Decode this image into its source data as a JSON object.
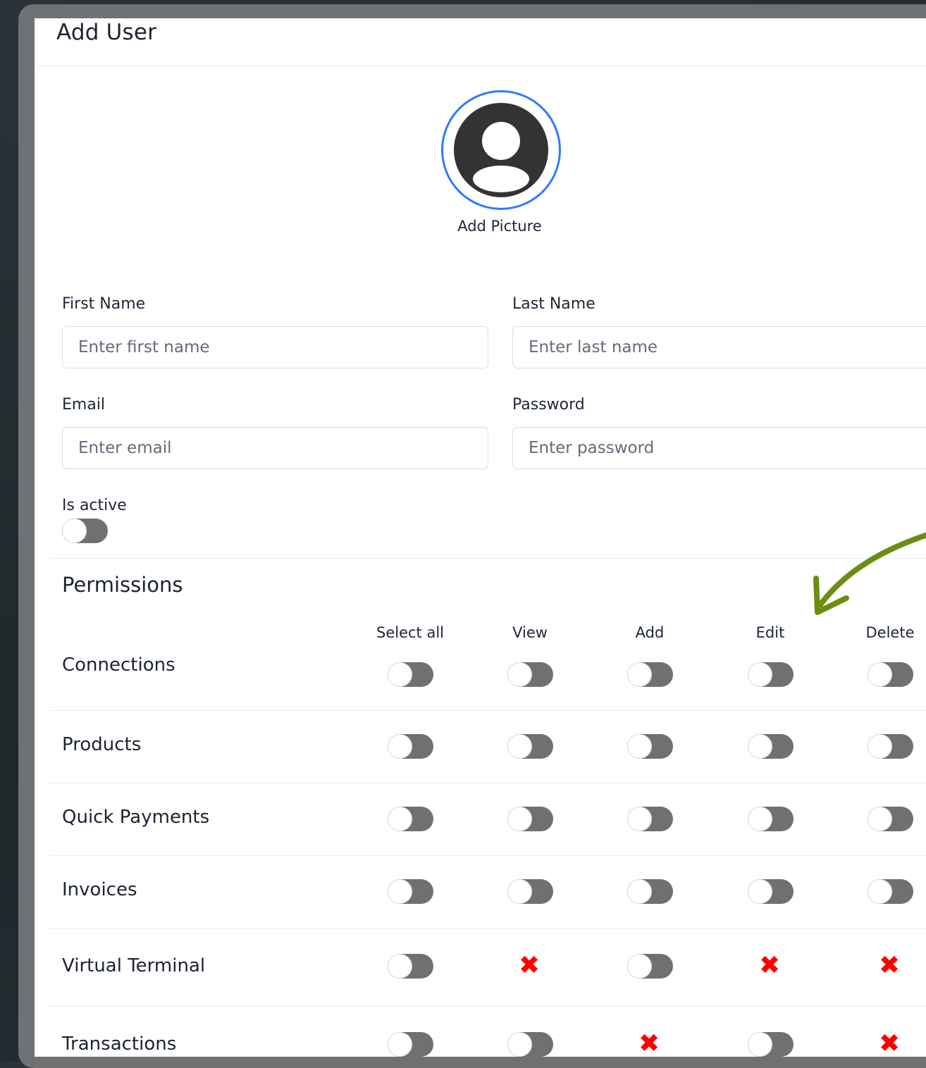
{
  "dialog": {
    "title": "Add User"
  },
  "picture": {
    "label": "Add Picture"
  },
  "form": {
    "first_name": {
      "label": "First Name",
      "placeholder": "Enter first name"
    },
    "last_name": {
      "label": "Last Name",
      "placeholder": "Enter last name"
    },
    "email": {
      "label": "Email",
      "placeholder": "Enter email"
    },
    "password": {
      "label": "Password",
      "placeholder": "Enter password"
    },
    "is_active": {
      "label": "Is active",
      "value": false
    }
  },
  "permissions": {
    "title": "Permissions",
    "columns": [
      "Select all",
      "View",
      "Add",
      "Edit",
      "Delete"
    ],
    "rows": [
      {
        "label": "Connections",
        "cells": [
          "toggle",
          "toggle",
          "toggle",
          "toggle",
          "toggle"
        ]
      },
      {
        "label": "Products",
        "cells": [
          "toggle",
          "toggle",
          "toggle",
          "toggle",
          "toggle"
        ]
      },
      {
        "label": "Quick Payments",
        "cells": [
          "toggle",
          "toggle",
          "toggle",
          "toggle",
          "toggle"
        ]
      },
      {
        "label": "Invoices",
        "cells": [
          "toggle",
          "toggle",
          "toggle",
          "toggle",
          "toggle"
        ]
      },
      {
        "label": "Virtual Terminal",
        "cells": [
          "toggle",
          "unavailable",
          "toggle",
          "unavailable",
          "unavailable"
        ]
      },
      {
        "label": "Transactions",
        "cells": [
          "toggle",
          "toggle",
          "unavailable",
          "toggle",
          "unavailable"
        ]
      }
    ],
    "unavailable_glyph": "✖"
  },
  "annotation": {
    "arrow_color": "#6b8e12"
  },
  "colors": {
    "accent": "#2f7bff",
    "toggle_off": "#707070",
    "unavailable": "#ff0000"
  }
}
